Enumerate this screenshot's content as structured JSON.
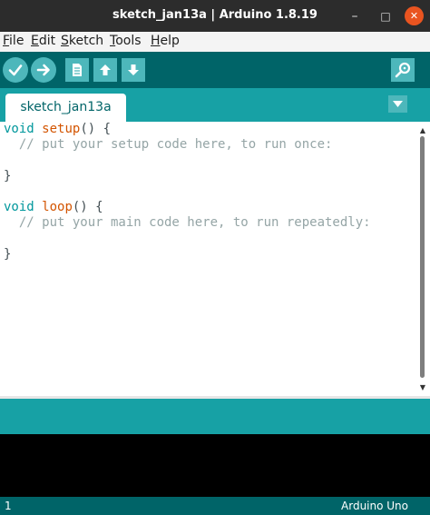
{
  "window": {
    "title": "sketch_jan13a | Arduino 1.8.19",
    "controls": {
      "minimize": "–",
      "maximize": "□",
      "close": "✕"
    }
  },
  "menubar": {
    "items": [
      {
        "label": "File",
        "underline": "F",
        "rest": "ile"
      },
      {
        "label": "Edit",
        "underline": "E",
        "rest": "dit"
      },
      {
        "label": "Sketch",
        "underline": "S",
        "rest": "ketch"
      },
      {
        "label": "Tools",
        "underline": "T",
        "rest": "ools"
      },
      {
        "label": "Help",
        "underline": "H",
        "rest": "elp"
      }
    ]
  },
  "toolbar": {
    "buttons": [
      {
        "name": "verify",
        "icon": "check-icon"
      },
      {
        "name": "upload",
        "icon": "arrow-right-icon"
      },
      {
        "name": "new",
        "icon": "new-file-icon"
      },
      {
        "name": "open",
        "icon": "arrow-up-icon"
      },
      {
        "name": "save",
        "icon": "arrow-down-icon"
      },
      {
        "name": "serial-monitor",
        "icon": "magnifier-icon"
      }
    ]
  },
  "tabs": [
    {
      "label": "sketch_jan13a",
      "active": true
    }
  ],
  "editor": {
    "lines": [
      [
        {
          "t": "void",
          "c": "kw"
        },
        {
          "t": " "
        },
        {
          "t": "setup",
          "c": "fn"
        },
        {
          "t": "() {"
        }
      ],
      [
        {
          "t": "  "
        },
        {
          "t": "// put your setup code here, to run once:",
          "c": "cm"
        }
      ],
      [],
      [
        {
          "t": "}"
        }
      ],
      [],
      [
        {
          "t": "void",
          "c": "kw"
        },
        {
          "t": " "
        },
        {
          "t": "loop",
          "c": "fn"
        },
        {
          "t": "() {"
        }
      ],
      [
        {
          "t": "  "
        },
        {
          "t": "// put your main code here, to run repeatedly:",
          "c": "cm"
        }
      ],
      [],
      [
        {
          "t": "}"
        }
      ]
    ]
  },
  "status_bar": {
    "line": "1",
    "board": "Arduino Uno"
  },
  "colors": {
    "titlebar": "#2c2c2c",
    "toolbar": "#006468",
    "toolbar_button": "#4db7bb",
    "tabbar": "#17a1a5",
    "keyword": "#00979c",
    "function": "#d35400",
    "comment": "#95a5a6",
    "close_button": "#e95420"
  }
}
